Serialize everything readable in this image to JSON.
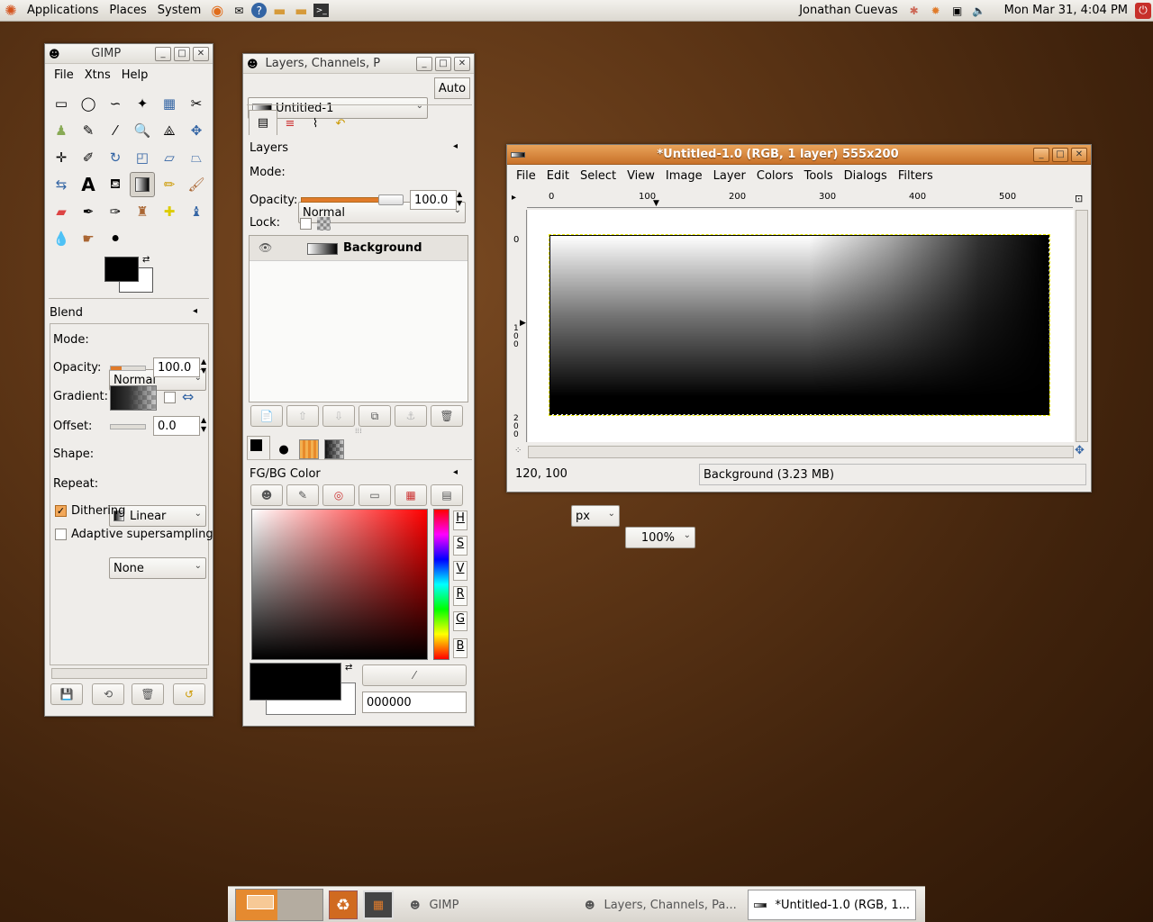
{
  "top_panel": {
    "menus": [
      "Applications",
      "Places",
      "System"
    ],
    "user": "Jonathan Cuevas",
    "datetime": "Mon Mar 31,  4:04 PM"
  },
  "toolbox": {
    "title": "GIMP",
    "menus": [
      "File",
      "Xtns",
      "Help"
    ],
    "blend": {
      "title": "Blend",
      "mode_label": "Mode:",
      "mode": "Normal",
      "opacity_label": "Opacity:",
      "opacity": "100.0",
      "gradient_label": "Gradient:",
      "offset_label": "Offset:",
      "offset": "0.0",
      "shape_label": "Shape:",
      "shape": "Linear",
      "repeat_label": "Repeat:",
      "repeat": "None",
      "dithering": "Dithering",
      "adaptive": "Adaptive supersampling",
      "dithering_checked": true,
      "adaptive_checked": false
    }
  },
  "layers": {
    "title": "Layers, Channels, P",
    "image": "Untitled-1",
    "auto": "Auto",
    "panel_title": "Layers",
    "mode_label": "Mode:",
    "mode": "Normal",
    "opacity_label": "Opacity:",
    "opacity": "100.0",
    "lock_label": "Lock:",
    "items": [
      {
        "name": "Background",
        "visible": true
      }
    ],
    "fgbg_title": "FG/BG Color",
    "channels": [
      "H",
      "S",
      "V",
      "R",
      "G",
      "B"
    ],
    "hex": "000000"
  },
  "image_window": {
    "title": "*Untitled-1.0 (RGB, 1 layer) 555x200",
    "menus": [
      "File",
      "Edit",
      "Select",
      "View",
      "Image",
      "Layer",
      "Colors",
      "Tools",
      "Dialogs",
      "Filters"
    ],
    "ruler_h": [
      "0",
      "100",
      "200",
      "300",
      "400",
      "500"
    ],
    "ruler_v": [
      "0",
      "1\n0\n0",
      "2\n0\n0"
    ],
    "coords": "120, 100",
    "unit": "px",
    "zoom": "100%",
    "status": "Background (3.23 MB)"
  },
  "taskbar": {
    "items": [
      "GIMP",
      "Layers, Channels, Pa...",
      "*Untitled-1.0 (RGB, 1..."
    ]
  },
  "colors": {
    "accent": "#e07b2a",
    "titlebar_active": "#d6893c"
  }
}
